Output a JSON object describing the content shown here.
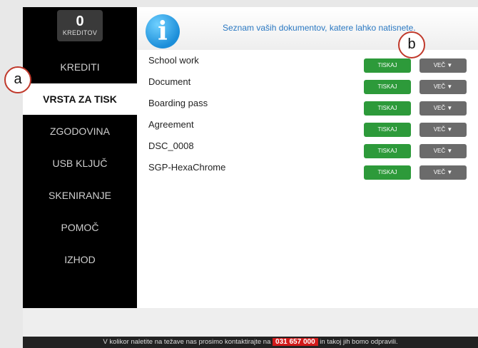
{
  "sidebar": {
    "credits": {
      "value": "0",
      "label": "KREDITOV"
    },
    "items": [
      {
        "label": "KREDITI"
      },
      {
        "label": "VRSTA ZA TISK"
      },
      {
        "label": "ZGODOVINA"
      },
      {
        "label": "USB KLJUČ"
      },
      {
        "label": "SKENIRANJE"
      },
      {
        "label": "POMOČ"
      },
      {
        "label": "IZHOD"
      }
    ]
  },
  "header": {
    "icon": "info-icon",
    "icon_glyph": "i",
    "message": "Seznam vaših dokumentov, katere lahko natisnete."
  },
  "documents": [
    {
      "name": "School work",
      "print": "TISKAJ",
      "more": "VEČ ▼"
    },
    {
      "name": "Document",
      "print": "TISKAJ",
      "more": "VEČ ▼"
    },
    {
      "name": "Boarding pass",
      "print": "TISKAJ",
      "more": "VEČ ▼"
    },
    {
      "name": "Agreement",
      "print": "TISKAJ",
      "more": "VEČ ▼"
    },
    {
      "name": "DSC_0008",
      "print": "TISKAJ",
      "more": "VEČ ▼"
    },
    {
      "name": "SGP-HexaChrome",
      "print": "TISKAJ",
      "more": "VEČ ▼"
    }
  ],
  "footer": {
    "text_before": "V kolikor naletite na težave nas prosimo kontaktirajte na",
    "phone": "031 657 000",
    "text_after": "in takoj jih bomo odpravili."
  },
  "callouts": {
    "a": "a",
    "b": "b"
  },
  "colors": {
    "print_button": "#2d9a3a",
    "more_button": "#6b6b6b",
    "accent": "#2a78c2",
    "callout_border": "#c0392b"
  }
}
